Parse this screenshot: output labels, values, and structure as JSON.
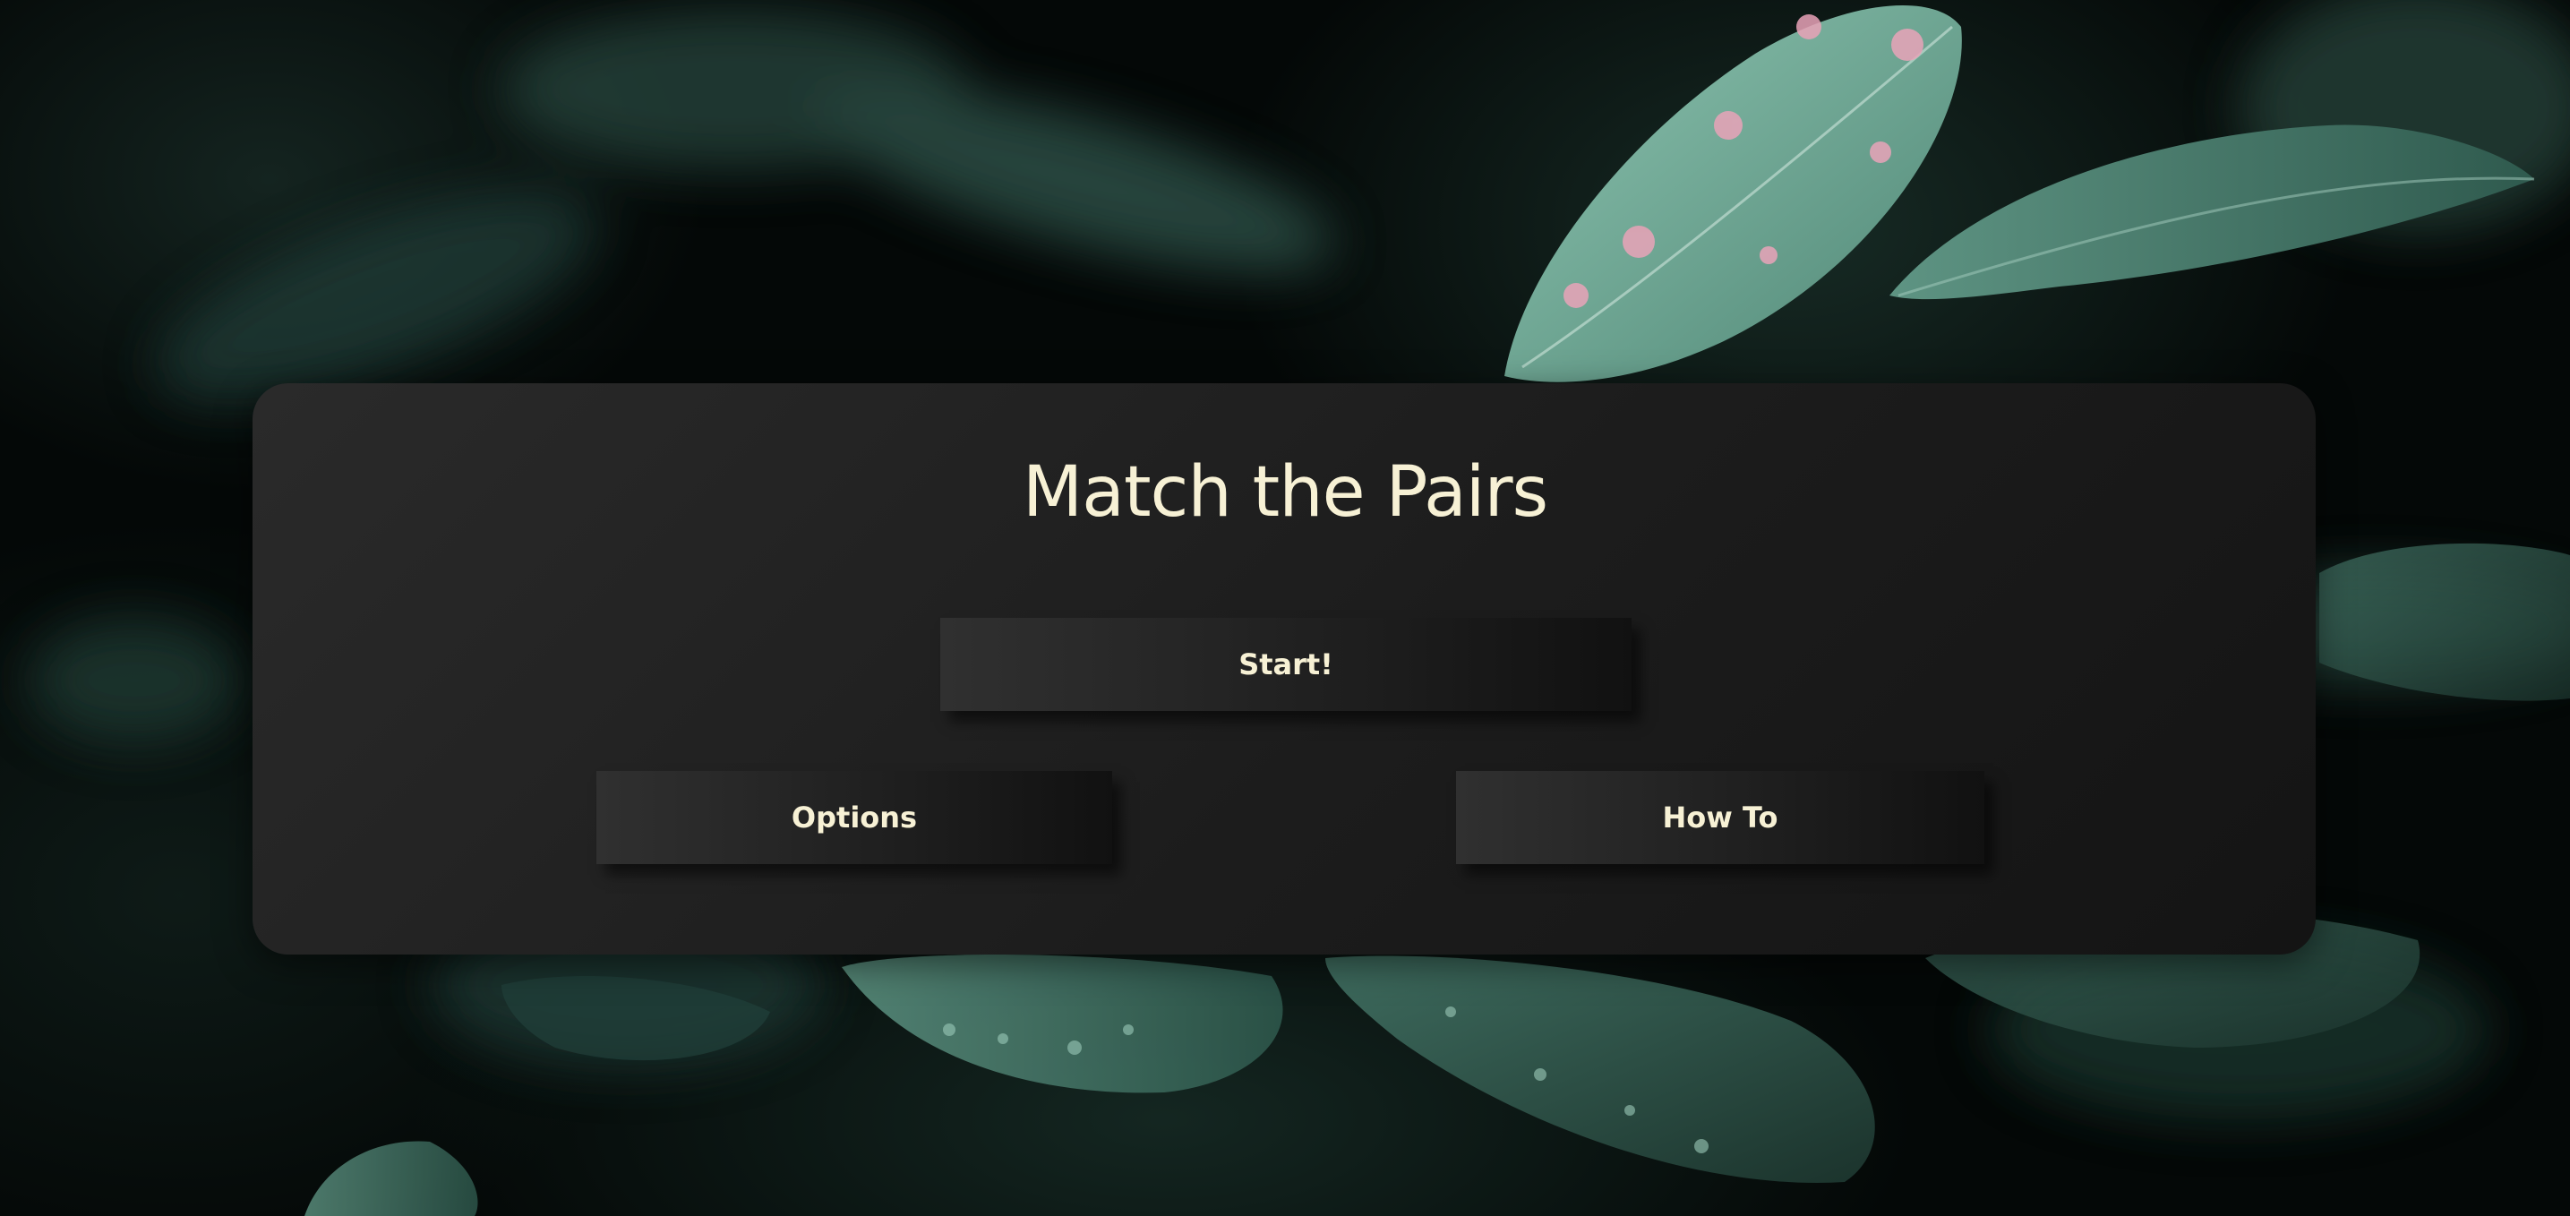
{
  "game": {
    "title": "Match the Pairs"
  },
  "menu": {
    "start_label": "Start!",
    "options_label": "Options",
    "howto_label": "How To"
  },
  "colors": {
    "text": "#f7f1d5",
    "panel": "#1e1e1e",
    "leaf": "#7fb5a2",
    "leaf_highlight": "#e9a3b8"
  },
  "background": {
    "icon": "wet-leaves-photo"
  }
}
